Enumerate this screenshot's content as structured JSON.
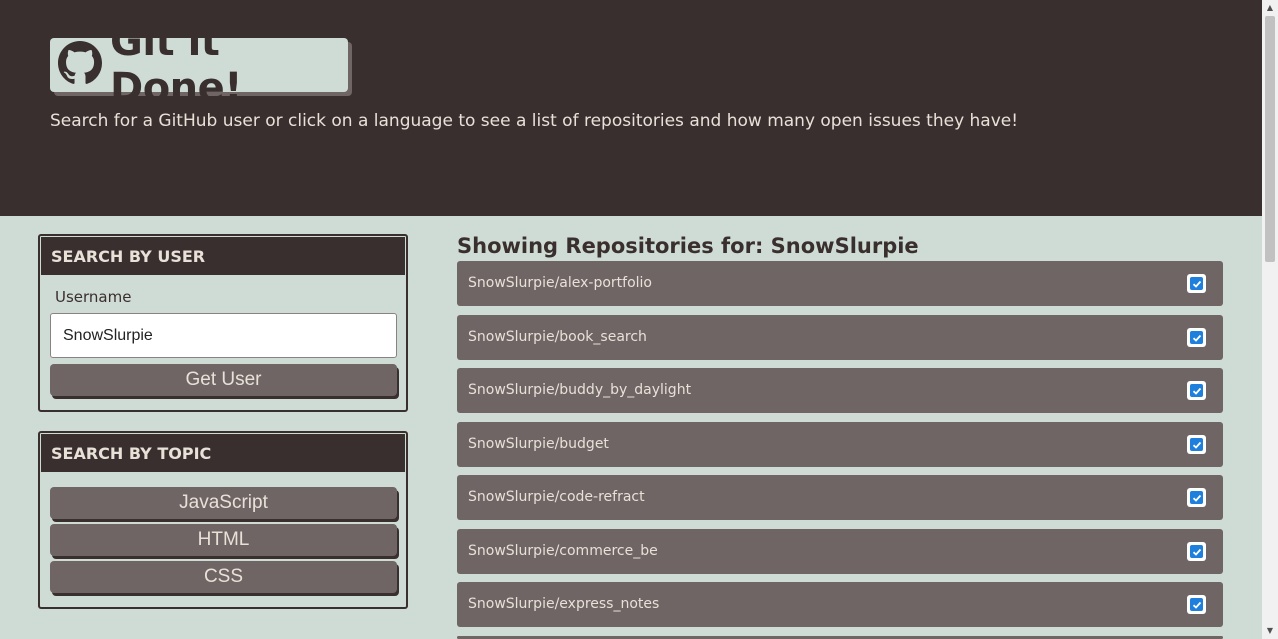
{
  "header": {
    "title": "Git it Done!",
    "subtitle": "Search for a GitHub user or click on a language to see a list of repositories and how many open issues they have!",
    "logo_icon": "github-icon"
  },
  "user_search": {
    "heading": "SEARCH BY USER",
    "label": "Username",
    "value": "SnowSlurpie",
    "button": "Get User"
  },
  "topic_search": {
    "heading": "SEARCH BY TOPIC",
    "buttons": [
      "JavaScript",
      "HTML",
      "CSS"
    ]
  },
  "repos": {
    "title": "Showing Repositories for: SnowSlurpie",
    "items": [
      {
        "name": "SnowSlurpie/alex-portfolio",
        "checked": true
      },
      {
        "name": "SnowSlurpie/book_search",
        "checked": true
      },
      {
        "name": "SnowSlurpie/buddy_by_daylight",
        "checked": true
      },
      {
        "name": "SnowSlurpie/budget",
        "checked": true
      },
      {
        "name": "SnowSlurpie/code-refract",
        "checked": true
      },
      {
        "name": "SnowSlurpie/commerce_be",
        "checked": true
      },
      {
        "name": "SnowSlurpie/express_notes",
        "checked": true
      }
    ]
  },
  "colors": {
    "dark": "#3a2f2f",
    "background": "#cfdcd5",
    "item": "#6f6565",
    "check": "#1e7fdc"
  }
}
